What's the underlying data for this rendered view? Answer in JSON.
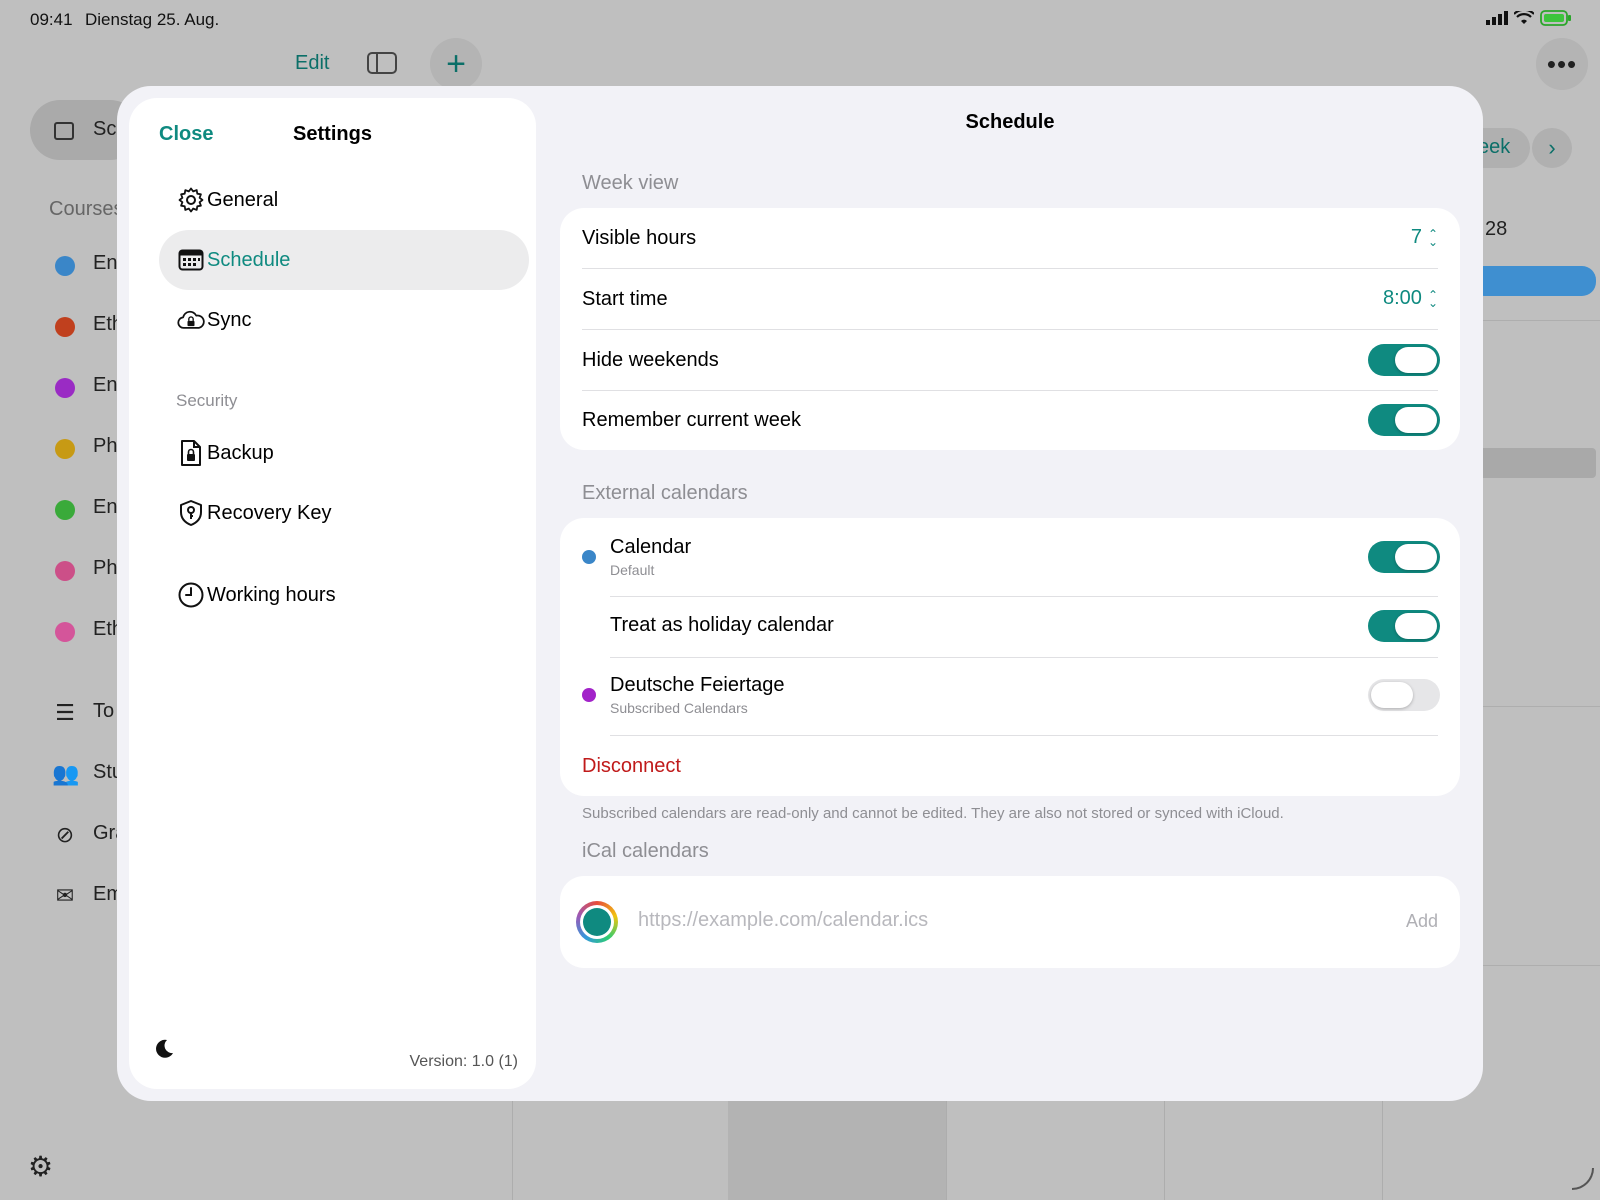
{
  "status_bar": {
    "time": "09:41",
    "date": "Dienstag 25. Aug."
  },
  "background": {
    "toolbar": {
      "edit_label": "Edit"
    },
    "sidebar": {
      "selected_item": "Sc",
      "courses_header": "Courses",
      "courses": [
        {
          "label": "En",
          "color": "#3a86c8"
        },
        {
          "label": "Eth",
          "color": "#c0401e"
        },
        {
          "label": "En",
          "color": "#9a2bc4"
        },
        {
          "label": "Ph",
          "color": "#c79a14"
        },
        {
          "label": "En",
          "color": "#3aaa3a"
        },
        {
          "label": "Ph",
          "color": "#cc4f88"
        },
        {
          "label": "Eth",
          "color": "#d4559a"
        }
      ],
      "items": [
        {
          "label": "To",
          "icon": "checklist-icon"
        },
        {
          "label": "Stu",
          "icon": "people-icon"
        },
        {
          "label": "Gra",
          "icon": "grade-icon"
        },
        {
          "label": "Em",
          "icon": "envelope-icon"
        }
      ]
    },
    "week_button": "eek",
    "day_label": "i 28"
  },
  "settings": {
    "close_label": "Close",
    "title": "Settings",
    "nav": [
      {
        "label": "General",
        "icon": "gear-icon"
      },
      {
        "label": "Schedule",
        "icon": "calendar-icon",
        "active": true
      },
      {
        "label": "Sync",
        "icon": "cloud-lock-icon"
      }
    ],
    "security_header": "Security",
    "security_nav": [
      {
        "label": "Backup",
        "icon": "document-lock-icon"
      },
      {
        "label": "Recovery Key",
        "icon": "key-shield-icon"
      }
    ],
    "working_hours": {
      "label": "Working hours",
      "icon": "clock-icon"
    },
    "version": "Version: 1.0 (1)"
  },
  "schedule": {
    "title": "Schedule",
    "week_view": {
      "header": "Week view",
      "visible_hours": {
        "label": "Visible hours",
        "value": "7"
      },
      "start_time": {
        "label": "Start time",
        "value": "8:00"
      },
      "hide_weekends": {
        "label": "Hide weekends",
        "on": true
      },
      "remember_week": {
        "label": "Remember current week",
        "on": true
      }
    },
    "external": {
      "header": "External calendars",
      "calendar": {
        "name": "Calendar",
        "subtitle": "Default",
        "color": "#3a86c8",
        "on": true
      },
      "holiday": {
        "label": "Treat as holiday calendar",
        "on": true
      },
      "feiertage": {
        "name": "Deutsche Feiertage",
        "subtitle": "Subscribed Calendars",
        "color": "#a223c9",
        "on": false
      },
      "disconnect_label": "Disconnect",
      "footnote": "Subscribed calendars are read-only and cannot be edited. They are also not stored or synced with iCloud."
    },
    "ical": {
      "header": "iCal calendars",
      "placeholder": "https://example.com/calendar.ics",
      "add_label": "Add",
      "color": "#0f8a80"
    }
  }
}
